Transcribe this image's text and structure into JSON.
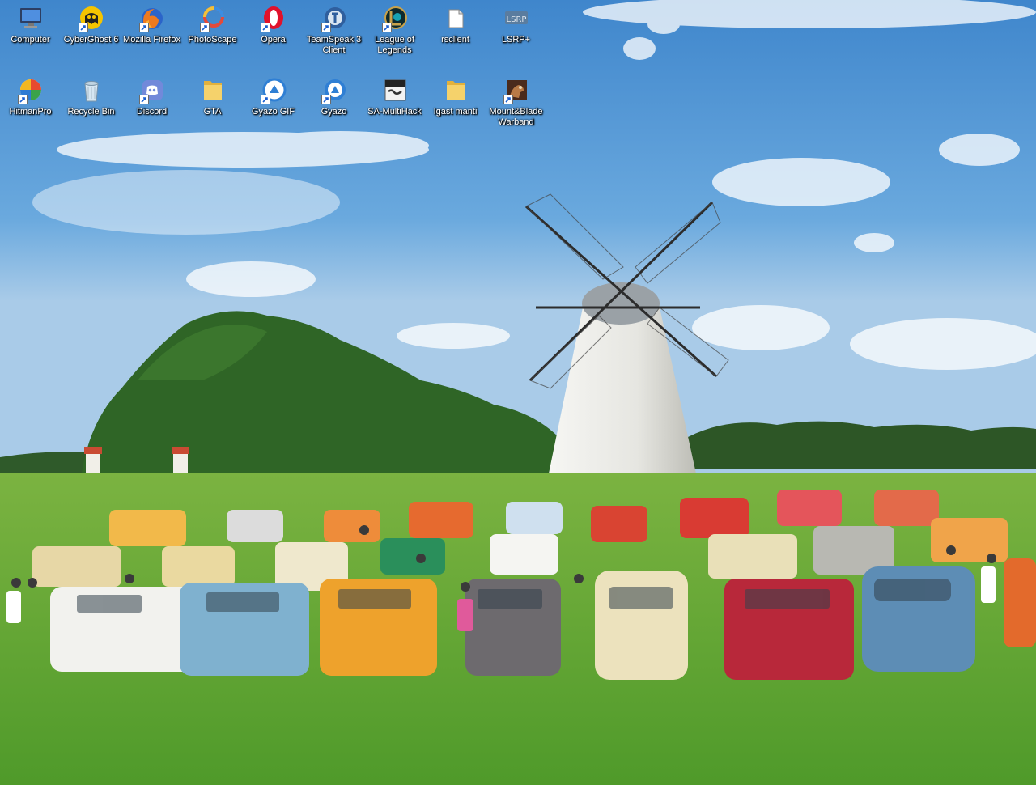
{
  "desktop": {
    "icons": [
      {
        "label": "Computer",
        "icon": "computer-icon",
        "shortcut": false
      },
      {
        "label": "CyberGhost 6",
        "icon": "cyberghost-icon",
        "shortcut": true
      },
      {
        "label": "Mozilla Firefox",
        "icon": "firefox-icon",
        "shortcut": true
      },
      {
        "label": "PhotoScape",
        "icon": "photoscape-icon",
        "shortcut": true
      },
      {
        "label": "Opera",
        "icon": "opera-icon",
        "shortcut": true
      },
      {
        "label": "TeamSpeak 3 Client",
        "icon": "teamspeak-icon",
        "shortcut": true
      },
      {
        "label": "League of Legends",
        "icon": "league-of-legends-icon",
        "shortcut": true
      },
      {
        "label": "rsclient",
        "icon": "file-icon",
        "shortcut": false
      },
      {
        "label": "LSRP+",
        "icon": "lsrp-icon",
        "shortcut": false
      },
      {
        "label": "HitmanPro",
        "icon": "hitmanpro-icon",
        "shortcut": true
      },
      {
        "label": "Recycle Bin",
        "icon": "recycle-bin-icon",
        "shortcut": false
      },
      {
        "label": "Discord",
        "icon": "discord-icon",
        "shortcut": true
      },
      {
        "label": "GTA",
        "icon": "folder-icon",
        "shortcut": false
      },
      {
        "label": "Gyazo GIF",
        "icon": "gyazo-gif-icon",
        "shortcut": true
      },
      {
        "label": "Gyazo",
        "icon": "gyazo-icon",
        "shortcut": true
      },
      {
        "label": "SA-MultiHack",
        "icon": "sa-multihack-icon",
        "shortcut": false
      },
      {
        "label": "Igast manti",
        "icon": "folder-icon",
        "shortcut": false
      },
      {
        "label": "Mount&Blade Warband",
        "icon": "mount-blade-icon",
        "shortcut": true
      }
    ]
  },
  "wallpaper": {
    "subject": "windmill-with-cars-wallpaper"
  }
}
